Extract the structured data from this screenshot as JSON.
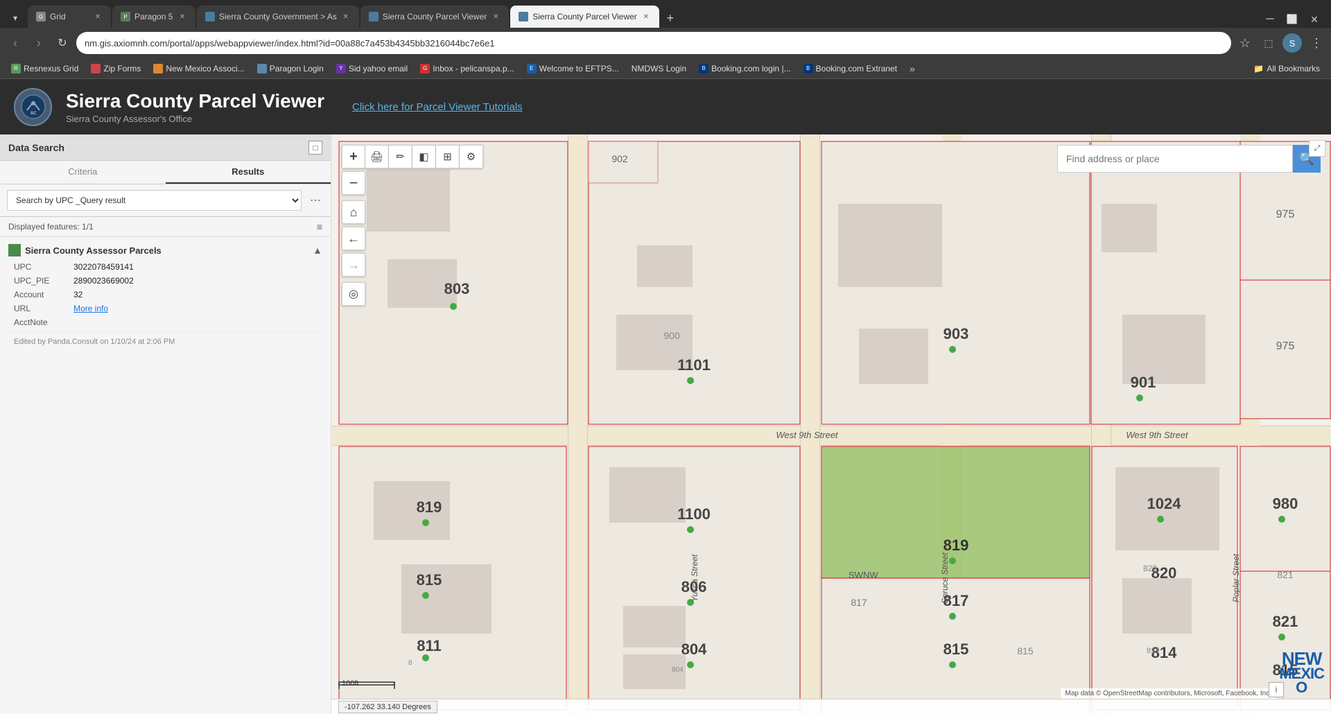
{
  "browser": {
    "tabs": [
      {
        "id": "tab1",
        "label": "Grid",
        "favicon_color": "#888",
        "active": false
      },
      {
        "id": "tab2",
        "label": "Paragon 5",
        "favicon_color": "#888",
        "active": false
      },
      {
        "id": "tab3",
        "label": "Sierra County Government > As",
        "favicon_color": "#888",
        "active": false
      },
      {
        "id": "tab4",
        "label": "Sierra County Parcel Viewer",
        "favicon_color": "#888",
        "active": false
      },
      {
        "id": "tab5",
        "label": "Sierra County Parcel Viewer",
        "favicon_color": "#4a7c9e",
        "active": true
      }
    ],
    "url": "nm.gis.axiomnh.com/portal/apps/webappviewer/index.html?id=00a88c7a453b4345bb3216044bc7e6e1",
    "bookmarks": [
      {
        "label": "Resnexus Grid",
        "favicon": "R"
      },
      {
        "label": "Zip Forms",
        "favicon": "Z"
      },
      {
        "label": "New Mexico Associ...",
        "favicon": "NM"
      },
      {
        "label": "Paragon Login",
        "favicon": "P"
      },
      {
        "label": "Sid yahoo email",
        "favicon": "Y"
      },
      {
        "label": "Inbox - pelicanspa.p...",
        "favicon": "G"
      },
      {
        "label": "Welcome to EFTPS...",
        "favicon": "E"
      },
      {
        "label": "NMDWS Login",
        "favicon": "N"
      },
      {
        "label": "Booking.com login |...",
        "favicon": "B"
      },
      {
        "label": "Booking.com Extranet",
        "favicon": "B"
      }
    ],
    "all_bookmarks_label": "All Bookmarks"
  },
  "app": {
    "title": "Sierra County Parcel Viewer",
    "subtitle": "Sierra County Assessor's Office",
    "tutorial_link": "Click here for Parcel Viewer Tutorials"
  },
  "sidebar": {
    "title": "Data Search",
    "tab_criteria": "Criteria",
    "tab_results": "Results",
    "active_tab": "Results",
    "dropdown_value": "Search by UPC _Query result",
    "displayed_features": "Displayed features: 1/1",
    "section_title": "Sierra County Assessor Parcels",
    "fields": {
      "upc_label": "UPC",
      "upc_value": "3022078459141",
      "upc_pie_label": "UPC_PIE",
      "upc_pie_value": "2890023669002",
      "account_label": "Account",
      "account_value": "32",
      "url_label": "URL",
      "url_value": "More info",
      "acct_note_label": "AcctNote",
      "edited_by": "Edited by Panda.Consult on 1/10/24 at 2:06 PM"
    }
  },
  "map": {
    "search_placeholder": "Find address or place",
    "coordinates": "-107.262 33.140 Degrees",
    "scale_label": "100ft",
    "copyright": "Map data © OpenStreetMap contributors, Microsoft, Facebook, Inc.",
    "buttons": {
      "zoom_in": "+",
      "zoom_out": "−",
      "home": "⌂",
      "back": "←",
      "forward": "→",
      "locate": "◎"
    }
  }
}
